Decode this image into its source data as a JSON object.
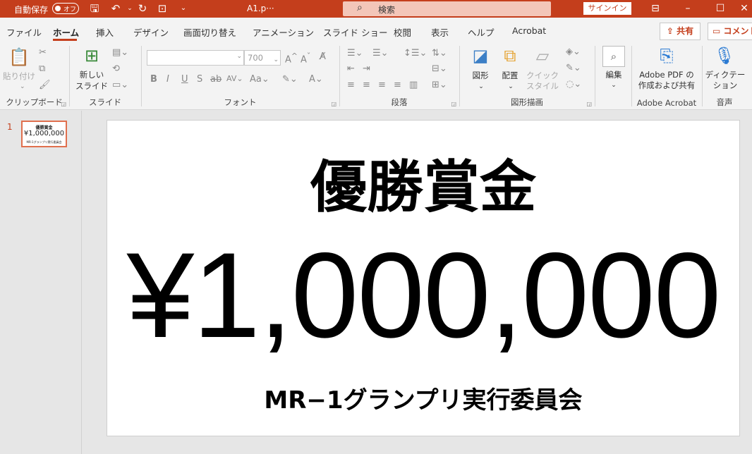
{
  "titlebar": {
    "autosave_label": "自動保存",
    "autosave_state": "オフ",
    "filename": "A1.p···",
    "search_placeholder": "検索",
    "signin_label": "サインイン",
    "accent_color": "#c43e1c"
  },
  "tabs": [
    {
      "label": "ファイル"
    },
    {
      "label": "ホーム"
    },
    {
      "label": "挿入"
    },
    {
      "label": "デザイン"
    },
    {
      "label": "画面切り替え"
    },
    {
      "label": "アニメーション"
    },
    {
      "label": "スライド ショー"
    },
    {
      "label": "校閲"
    },
    {
      "label": "表示"
    },
    {
      "label": "ヘルプ"
    },
    {
      "label": "Acrobat"
    }
  ],
  "active_tab": "ホーム",
  "share_label": "共有",
  "comment_label": "コメント",
  "ribbon": {
    "clipboard": {
      "name": "クリップボード",
      "paste": "貼り付け"
    },
    "slides": {
      "name": "スライド",
      "new_slide_l1": "新しい",
      "new_slide_l2": "スライド"
    },
    "font": {
      "name": "フォント",
      "font_name": "",
      "font_size": "700"
    },
    "paragraph": {
      "name": "段落"
    },
    "drawing": {
      "name": "図形描画",
      "shapes": "図形",
      "arrange": "配置",
      "quick_l1": "クイック",
      "quick_l2": "スタイル"
    },
    "editing": {
      "label": "編集"
    },
    "adobe": {
      "name": "Adobe Acrobat",
      "l1": "Adobe PDF の",
      "l2": "作成および共有"
    },
    "voice": {
      "name": "音声",
      "dictate_l1": "ディクテー",
      "dictate_l2": "ション"
    }
  },
  "slides_pane": {
    "slide_number": "1",
    "thumb_title": "優勝賞金",
    "thumb_amount": "¥1,000,000",
    "thumb_org": "MR-1グランプリ実行委員会"
  },
  "slide": {
    "title": "優勝賞金",
    "amount": "¥1,000,000",
    "organizer": "MR−1グランプリ実行委員会"
  }
}
